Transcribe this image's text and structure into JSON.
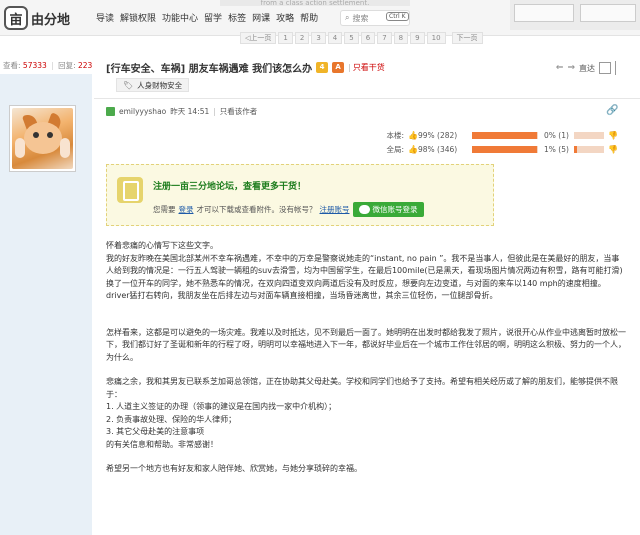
{
  "nav": {
    "logo_text": "由分地",
    "items": [
      "导读",
      "解锁权限",
      "功能中心",
      "留学",
      "标签",
      "网课",
      "攻略",
      "帮助"
    ],
    "search_label": "搜索",
    "search_shortcut": "Ctrl K",
    "banner_hint": "from a class action settlement."
  },
  "pager": {
    "items": [
      "◁上一页",
      "1",
      "2",
      "3",
      "4",
      "5",
      "6",
      "7",
      "8",
      "9",
      "10"
    ],
    "next": "下一页"
  },
  "stats": {
    "views_label": "查看:",
    "views": "57333",
    "replies_label": "回复:",
    "replies": "223"
  },
  "thread": {
    "title": "[行车安全、车祸] 朋友车祸遇难 我们该怎么办",
    "badge1": "4",
    "badge2": "A",
    "note_sep": "|",
    "note": "只看干货",
    "prev_label": "上一主题",
    "next_label": "直达",
    "tag": "人身财物安全"
  },
  "author": {
    "name": "emilyyyshao",
    "time": "昨天 14:51",
    "sep": "|",
    "only_author": "只看该作者"
  },
  "rating": {
    "rows": [
      {
        "label": "本楼:",
        "pct": "99% (282)",
        "fill": 0.99,
        "neg": "0% (1)",
        "neg_fill": 0
      },
      {
        "label": "全局:",
        "pct": "98% (346)",
        "fill": 0.98,
        "neg": "1% (5)",
        "neg_fill": 0.01
      }
    ]
  },
  "register": {
    "title": "注册一亩三分地论坛，查看更多干货！",
    "need": "您需要",
    "login": "登录",
    "mid": "才可以下载或查看附件。没有帐号？",
    "signup": "注册账号",
    "wechat": "微信账号登录"
  },
  "body": {
    "p1": "怀着悲痛的心情写下这些文字。",
    "p2": "我的好友昨晚在美国北部某州不幸车祸遇难，不幸中的万幸是警察说她走的“instant, no pain ”。我不是当事人，但彼此是在美最好的朋友，当事人给到我的情况是：一行五人驾驶一辆租的suv去滑雪，均为中国留学生，在最后100mile(已是黑天，看现场图片情况两边有积雪，路有可能打滑)换了一位开车的同学，她不熟悉车的情况，在双向四道变双向两道后没有及时反应，想要向左边变道，与对面的来车以140 mph的速度相撞。driver猛打右转向，我朋友坐在后排左边与对面车辆直接相撞，当场昏迷离世，其余三位轻伤，一位腿部骨折。",
    "p3": "怎样看来，这都是可以避免的一场灾难。我难以及时抵达，见不到最后一面了。她明明在出发时都给我发了照片，说很开心从作业中逃离暂时放松一下，我们都订好了圣诞和新年的行程了呀，明明可以幸福地进入下一年，都说好毕业后在一个城市工作住邻居的啊，明明这么积极、努力的一个人，为什么。",
    "p4": "悲痛之余，我和其男友已联系芝加哥总领馆，正在协助其父母赴美。学校和同学们也给予了支持。希望有相关经历或了解的朋友们，能够提供不限于：",
    "l1": "1. 人道主义签证的办理（领事的建议是在国内找一家中介机构）；",
    "l2": "2. 负责事故处理、保险的华人律师；",
    "l3": "3. 其它父母赴美的注意事项",
    "l4": "的有关信息和帮助。非常感谢！",
    "p5": "希望另一个地方也有好友和家人陪伴她、欣赏她，与她分享琐碎的幸福。"
  }
}
